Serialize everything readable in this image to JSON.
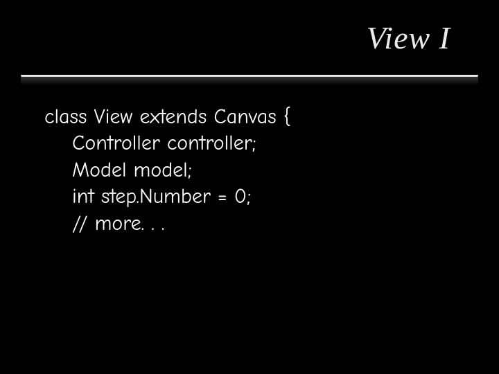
{
  "title": "View I",
  "code": {
    "line1": "class View extends Canvas {",
    "line2": "Controller controller;",
    "line3": "Model model;",
    "line4": "int step.Number = 0;",
    "line5": "// more. . ."
  }
}
